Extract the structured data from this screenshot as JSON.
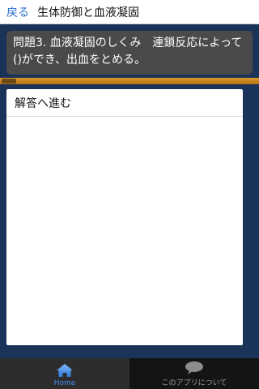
{
  "header": {
    "back_label": "戻る",
    "title": "生体防御と血液凝固"
  },
  "question": {
    "text": "問題3. 血液凝固のしくみ　連鎖反応によって()ができ、出血をとめる。"
  },
  "progress": {
    "fraction": 1.0
  },
  "panel": {
    "answer_button_label": "解答へ進む"
  },
  "tabs": [
    {
      "label": "Home",
      "icon": "home-icon",
      "active": true
    },
    {
      "label": "このアプリについて",
      "icon": "speech-bubble-icon",
      "active": false
    }
  ],
  "colors": {
    "background": "#1a3358",
    "accent": "#3d8ff0",
    "progress": "#d99a2b"
  }
}
